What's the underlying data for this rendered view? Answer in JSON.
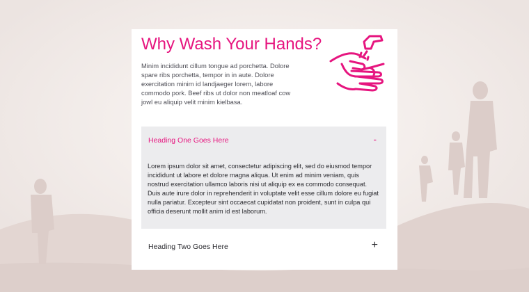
{
  "page": {
    "title": "Why Wash Your Hands?",
    "intro": "Minim incididunt cillum tongue ad porchetta. Dolore spare ribs porchetta, tempor in in aute. Dolore exercitation minim id landjaeger lorem, labore commodo pork. Beef ribs ut dolor non meatloaf cow jowl eu aliquip velit minim kielbasa.",
    "icon": "hand-washing-icon"
  },
  "accordion": {
    "items": [
      {
        "heading": "Heading One Goes Here",
        "toggle": "-",
        "expanded": true,
        "body": "Lorem ipsum dolor sit amet, consectetur adipiscing elit, sed do eiusmod tempor incididunt ut labore et dolore magna aliqua. Ut enim ad minim veniam, quis nostrud exercitation ullamco laboris nisi ut aliquip ex ea commodo consequat. Duis aute irure dolor in reprehenderit in voluptate velit esse cillum dolore eu fugiat nulla pariatur. Excepteur sint occaecat cupidatat non proident, sunt in culpa qui officia deserunt mollit anim id est laborum."
      },
      {
        "heading": "Heading Two Goes Here",
        "toggle": "+",
        "expanded": false
      }
    ]
  },
  "colors": {
    "accent": "#e6157f",
    "background": "#f1ecea",
    "panel": "#ececee",
    "text": "#2b2b30"
  }
}
